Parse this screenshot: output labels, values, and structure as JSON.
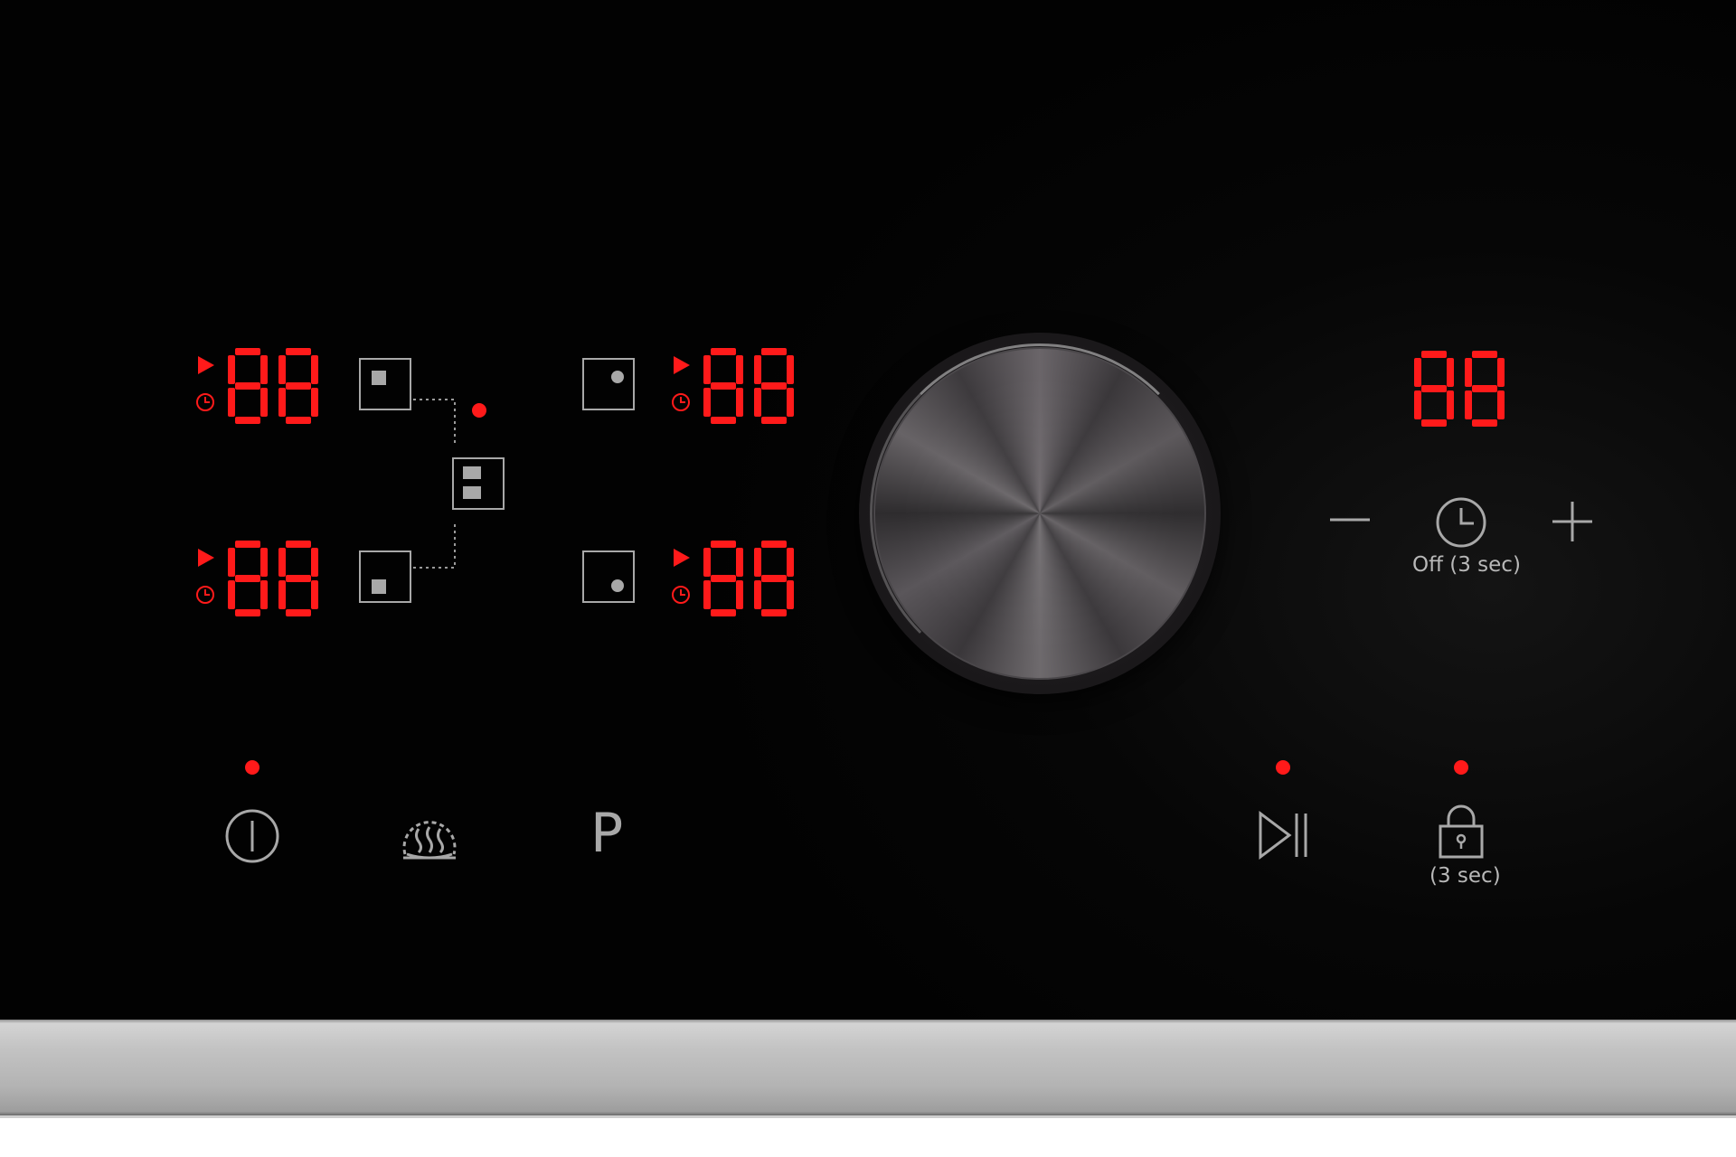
{
  "zones": {
    "front_left": {
      "display": "88",
      "icon": "zone-front-left-icon"
    },
    "rear_left": {
      "display": "88",
      "icon": "zone-rear-left-icon"
    },
    "rear_right": {
      "display": "88",
      "icon": "zone-rear-right-icon"
    },
    "front_right": {
      "display": "88",
      "icon": "zone-front-right-icon"
    },
    "bridge": {
      "icon": "flex-zone-bridge-icon"
    }
  },
  "timer": {
    "display": "88",
    "minus_icon": "minus-icon",
    "clock_icon": "clock-icon",
    "plus_icon": "plus-icon",
    "clock_label": "Off (3 sec)"
  },
  "controls": {
    "power_icon": "power-icon",
    "keep_warm_icon": "keep-warm-icon",
    "boost_label": "P",
    "pause_icon": "play-pause-icon",
    "lock_icon": "padlock-icon",
    "lock_label": "(3 sec)"
  },
  "colors": {
    "led_red": "#ff1a1a",
    "symbol_grey": "#a8a8a8",
    "panel_black": "#050505",
    "trim_steel": "#c3c3c3"
  }
}
